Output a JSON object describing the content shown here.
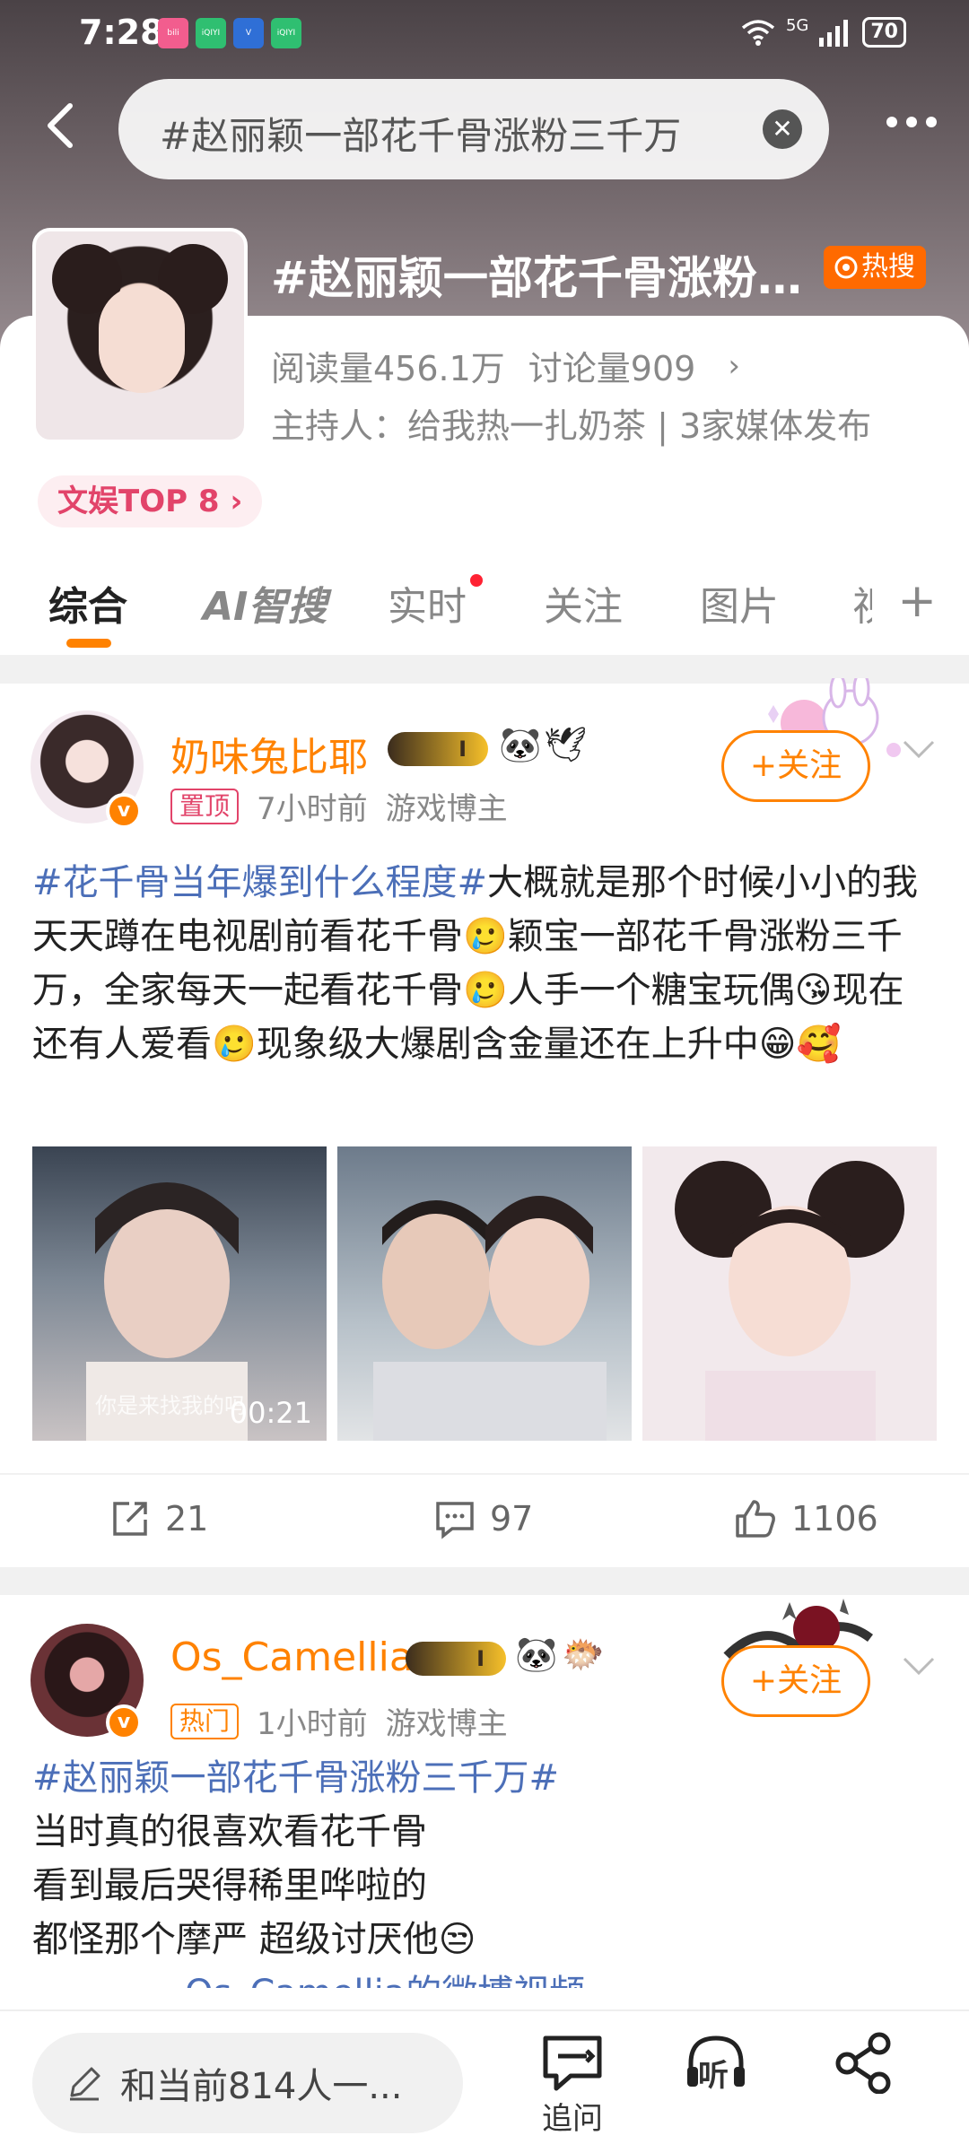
{
  "status": {
    "time": "7:28",
    "battery": "70",
    "network": "5G",
    "apps": [
      "bilibili",
      "iQIYI 会员",
      "V",
      "iQIYI 会员"
    ]
  },
  "search": {
    "query": "#赵丽颖一部花千骨涨粉三千万"
  },
  "topic": {
    "title": "#赵丽颖一部花千骨涨粉三千万#",
    "hot_label": "热搜",
    "read_count": "阅读量456.1万",
    "discussion_count": "讨论量909",
    "host": "主持人：给我热一扎奶茶 | 3家媒体发布",
    "rank_tag": "文娱TOP 8"
  },
  "tabs": [
    "综合",
    "AI智搜",
    "实时",
    "关注",
    "图片",
    "视"
  ],
  "posts": [
    {
      "username": "奶味兔比耶",
      "level": "I",
      "tag": "置顶",
      "time": "7小时前",
      "role": "游戏博主",
      "follow_label": "+关注",
      "hashtag": "#花千骨当年爆到什么程度#",
      "text": "大概就是那个时候小小的我天天蹲在电视剧前看花千骨🥲颖宝一部花千骨涨粉三千万，全家每天一起看花千骨🥲人手一个糖宝玩偶😘现在还有人爱看🥲现象级大爆剧含金量还在上升中😁🥰",
      "video_caption": "你是来找我的吗",
      "video_duration": "00:21",
      "reposts": "21",
      "comments": "97",
      "likes": "1106"
    },
    {
      "username": "Os_Camellia",
      "level": "I",
      "tag": "热门",
      "time": "1小时前",
      "role": "游戏博主",
      "follow_label": "+关注",
      "hashtag": "#赵丽颖一部花千骨涨粉三千万#",
      "lines": [
        "当时真的很喜欢看花千骨",
        "看到最后哭得稀里哗啦的",
        "都怪那个摩严 超级讨厌他😒"
      ],
      "cut_line": "Os_Camellia的微博视频"
    }
  ],
  "bottom_bar": {
    "comment_placeholder": "和当前814人一...",
    "ask_label": "追问",
    "listen_label": "听"
  },
  "colors": {
    "accent": "#ff8200",
    "hashtag": "#4c6fb8",
    "hot": "#ff6a00",
    "rank": "#e2446a"
  }
}
